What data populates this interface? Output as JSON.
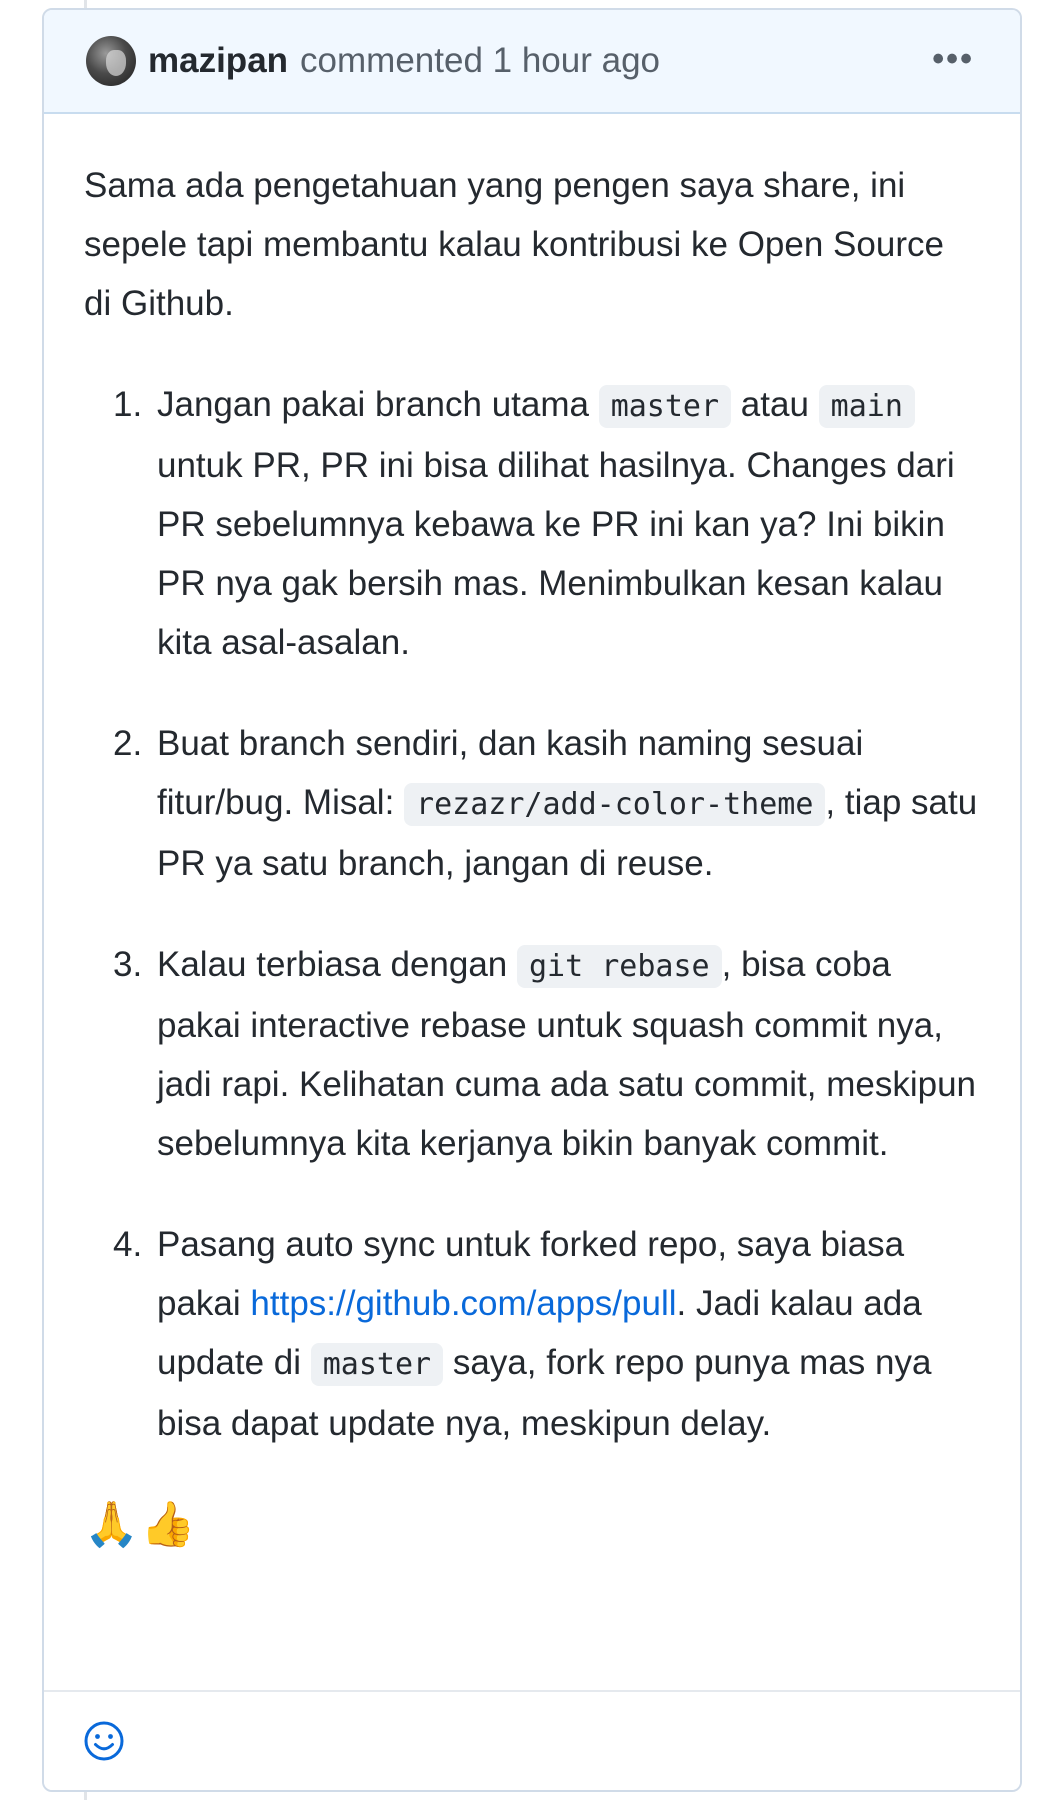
{
  "comment": {
    "author": "mazipan",
    "meta": "commented 1 hour ago",
    "menu_label": "•••",
    "intro": "Sama ada pengetahuan yang pengen saya share, ini sepele tapi membantu kalau kontribusi ke Open Source di Github.",
    "items": [
      {
        "num": "1.",
        "t1": "Jangan pakai branch utama ",
        "c1": "master",
        "t2": " atau ",
        "c2": "main",
        "t3": " untuk PR, PR ini bisa dilihat hasilnya. Changes dari PR sebelumnya kebawa ke PR ini kan ya? Ini bikin PR nya gak bersih mas. Menimbulkan kesan kalau kita asal-asalan."
      },
      {
        "num": "2.",
        "t1": "Buat branch sendiri, dan kasih naming sesuai fitur/bug. Misal: ",
        "c1": "rezazr/add-color-theme",
        "t2": ", tiap satu PR ya satu branch, jangan di reuse."
      },
      {
        "num": "3.",
        "t1": "Kalau terbiasa dengan ",
        "c1": "git rebase",
        "t2": ", bisa coba pakai interactive rebase untuk squash commit nya, jadi rapi. Kelihatan cuma ada satu commit, meskipun sebelumnya kita kerjanya bikin banyak commit."
      },
      {
        "num": "4.",
        "t1": "Pasang auto sync untuk forked repo, saya biasa pakai ",
        "link": "https://github.com/apps/pull",
        "t2": ". Jadi kalau ada update di ",
        "c1": "master",
        "t3": " saya, fork repo punya mas nya bisa dapat update nya, meskipun delay."
      }
    ],
    "emojis": [
      "🙏",
      "👍"
    ]
  },
  "colors": {
    "header_bg": "#f1f8ff",
    "link": "#0969da",
    "code_bg": "#eef1f4"
  },
  "icons": {
    "avatar": "avatar-image",
    "menu": "kebab-icon",
    "reaction": "smiley-icon"
  }
}
